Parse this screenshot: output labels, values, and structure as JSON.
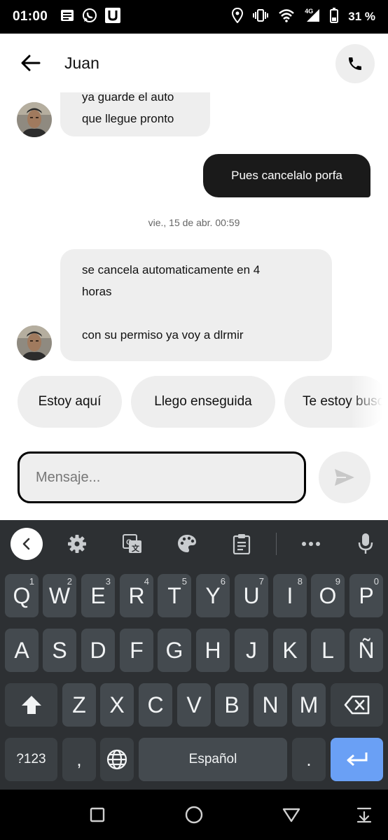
{
  "status_bar": {
    "time": "01:00",
    "network": "4G",
    "battery": "31 %",
    "left_icons": [
      "message-notification-icon",
      "whatsapp-icon",
      "uber-icon"
    ],
    "right_icons": [
      "location-icon",
      "vibrate-icon",
      "wifi-icon",
      "signal-icon",
      "battery-icon"
    ]
  },
  "header": {
    "contact_name": "Juan",
    "back_icon": "arrow-left-icon",
    "call_icon": "phone-icon"
  },
  "messages": {
    "incoming_1": {
      "partial_line": "ya guarde el auto",
      "line": "que llegue pronto"
    },
    "outgoing_1": {
      "text": "Pues cancelalo porfa"
    },
    "timestamp": "vie., 15 de abr. 00:59",
    "incoming_2": {
      "line1": "se cancela automaticamente en 4",
      "line2": "horas",
      "line3": "con su permiso ya voy a dlrmir"
    }
  },
  "quick_replies": [
    "Estoy aquí",
    "Llego enseguida",
    "Te estoy buscando"
  ],
  "composer": {
    "placeholder": "Mensaje...",
    "send_icon": "send-icon"
  },
  "keyboard": {
    "toolbar_icons": [
      "chevron-left-icon",
      "settings-icon",
      "translate-icon",
      "palette-icon",
      "clipboard-icon",
      "more-icon",
      "microphone-icon"
    ],
    "row1": [
      {
        "k": "Q",
        "h": "1"
      },
      {
        "k": "W",
        "h": "2"
      },
      {
        "k": "E",
        "h": "3"
      },
      {
        "k": "R",
        "h": "4"
      },
      {
        "k": "T",
        "h": "5"
      },
      {
        "k": "Y",
        "h": "6"
      },
      {
        "k": "U",
        "h": "7"
      },
      {
        "k": "I",
        "h": "8"
      },
      {
        "k": "O",
        "h": "9"
      },
      {
        "k": "P",
        "h": "0"
      }
    ],
    "row2": [
      "A",
      "S",
      "D",
      "F",
      "G",
      "H",
      "J",
      "K",
      "L",
      "Ñ"
    ],
    "row3": [
      "Z",
      "X",
      "C",
      "V",
      "B",
      "N",
      "M"
    ],
    "symbols_label": "?123",
    "comma": ",",
    "space_label": "Español",
    "period": ".",
    "shift_icon": "shift-icon",
    "backspace_icon": "backspace-icon",
    "globe_icon": "globe-icon",
    "enter_icon": "enter-icon"
  },
  "nav_bar": {
    "icons": [
      "recents-icon",
      "home-icon",
      "back-icon",
      "notification-down-icon"
    ]
  },
  "colors": {
    "outgoing_bubble": "#1a1a1a",
    "incoming_bubble": "#eeeeee",
    "keyboard_bg": "#2d3033",
    "key_bg": "#444a4f",
    "enter_key": "#6aa0f5"
  }
}
